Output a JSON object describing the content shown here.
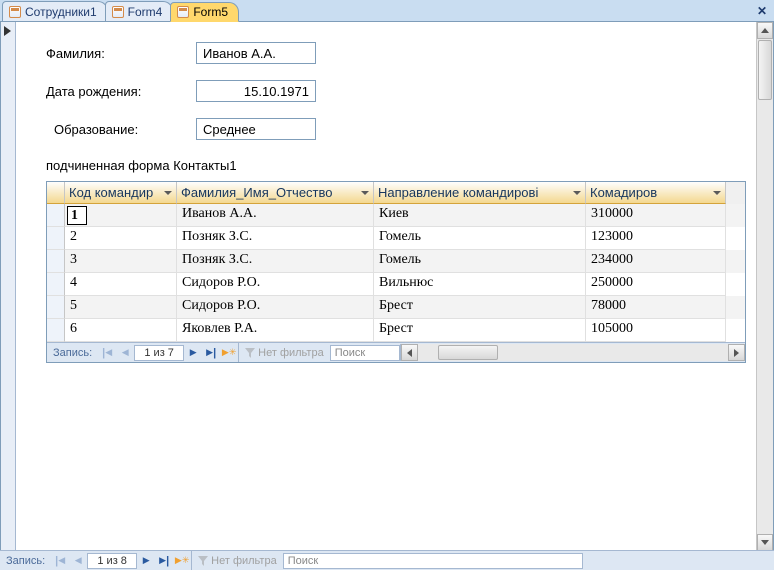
{
  "tabs": [
    {
      "label": "Сотрудники1",
      "active": false
    },
    {
      "label": "Form4",
      "active": false
    },
    {
      "label": "Form5",
      "active": true
    }
  ],
  "form": {
    "fields": {
      "lastname": {
        "label": "Фамилия:",
        "value": "Иванов А.А."
      },
      "birthdate": {
        "label": "Дата рождения:",
        "value": "15.10.1971"
      },
      "education": {
        "label": "Образование:",
        "value": "Среднее"
      }
    },
    "subform_label": "подчиненная форма Контакты1"
  },
  "grid": {
    "columns": [
      "Код командир",
      "Фамилия_Имя_Отчество",
      "Направление командирові",
      "Комадиров"
    ],
    "rows": [
      {
        "c1": "1",
        "c2": "Иванов А.А.",
        "c3": "Киев",
        "c4": "310000"
      },
      {
        "c1": "2",
        "c2": "Позняк З.С.",
        "c3": "Гомель",
        "c4": "123000"
      },
      {
        "c1": "3",
        "c2": "Позняк З.С.",
        "c3": "Гомель",
        "c4": "234000"
      },
      {
        "c1": "4",
        "c2": "Сидоров Р.О.",
        "c3": "Вильнюс",
        "c4": "250000"
      },
      {
        "c1": "5",
        "c2": "Сидоров Р.О.",
        "c3": "Брест",
        "c4": "78000"
      },
      {
        "c1": "6",
        "c2": "Яковлев Р.А.",
        "c3": "Брест",
        "c4": "105000"
      }
    ]
  },
  "subnav": {
    "label": "Запись:",
    "pos": "1 из 7",
    "filter": "Нет фильтра",
    "search": "Поиск"
  },
  "mainnav": {
    "label": "Запись:",
    "pos": "1 из 8",
    "filter": "Нет фильтра",
    "search": "Поиск"
  }
}
